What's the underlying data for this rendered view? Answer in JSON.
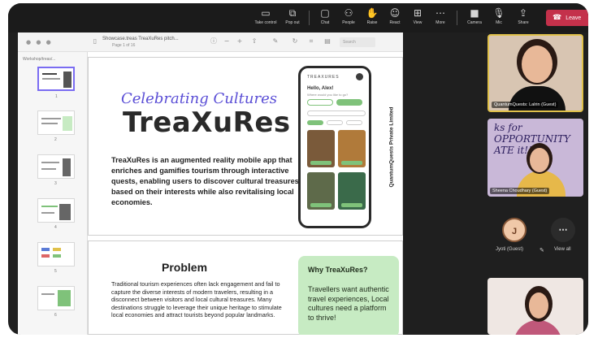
{
  "toolbar": {
    "buttons": [
      {
        "label": "Take control",
        "icon": "monitor-icon"
      },
      {
        "label": "Pop out",
        "icon": "popout-icon"
      },
      {
        "label": "Chat",
        "icon": "chat-icon"
      },
      {
        "label": "People",
        "icon": "people-icon"
      },
      {
        "label": "Raise",
        "icon": "hand-icon"
      },
      {
        "label": "React",
        "icon": "smiley-icon"
      },
      {
        "label": "View",
        "icon": "grid-icon"
      },
      {
        "label": "More",
        "icon": "ellipsis-icon"
      },
      {
        "label": "Camera",
        "icon": "camera-icon"
      },
      {
        "label": "Mic",
        "icon": "mic-off-icon"
      },
      {
        "label": "Share",
        "icon": "share-icon"
      }
    ],
    "leave_label": "Leave",
    "colors": {
      "leave": "#c4314b",
      "background": "#1b1b1b"
    }
  },
  "share": {
    "doc_title": "Showcase.treas TreaXuRes pitch...",
    "doc_sub": "Page 1 of 16",
    "search_placeholder": "Search",
    "thumbs_title": "Workshop/treas/...",
    "thumb_numbers": [
      "1",
      "2",
      "3",
      "4",
      "5",
      "6"
    ]
  },
  "slide1": {
    "script_title": "Celebrating Cultures",
    "brand": "TreaXuRes",
    "description": "TreaXuRes is an augmented reality mobile app that enriches and gamifies tourism through interactive quests, enabling users to discover cultural treasures based on their interests while also revitalising local economies.",
    "vertical_text": "QuantumQuests Private Limited",
    "phone": {
      "brand": "TREAXURES",
      "greeting": "Hello, Alex!",
      "subtitle": "Where would you like to go?"
    }
  },
  "slide2": {
    "problem_heading": "Problem",
    "problem_text": "Traditional tourism experiences often lack engagement and fail to capture the diverse interests of modern travelers, resulting in a disconnect between visitors and local cultural treasures. Many destinations struggle to leverage their unique heritage to stimulate local economies and attract tourists beyond popular landmarks.",
    "why_heading": "Why TreaXuRes?",
    "why_text": "Travellers want authentic travel experiences, Local cultures need a platform to thrive!",
    "colors": {
      "why_bg": "#c7ebc3"
    }
  },
  "participants": {
    "tile1_name": "QuantumQuests: Lalrin (Guest)",
    "tile2_name": "Sheena Choudhary (Guest)",
    "tile2_sign": "ks for OPPORTUNITY ATE it!!",
    "jyoti_initial": "J",
    "jyoti_label": "Jyoti (Guest)",
    "view_all_label": "View all"
  }
}
